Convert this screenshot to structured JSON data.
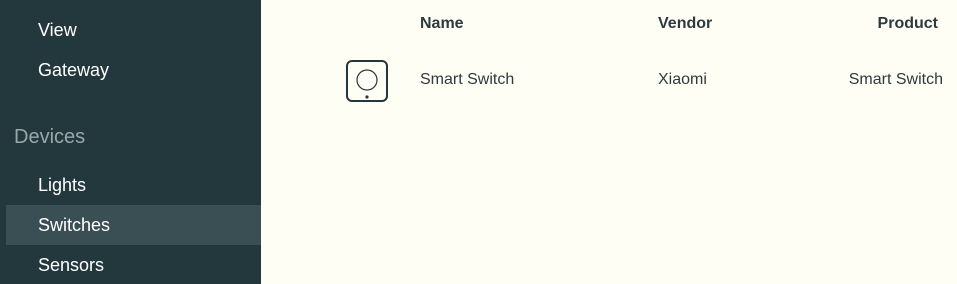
{
  "sidebar": {
    "items_top": [
      {
        "label": "View"
      },
      {
        "label": "Gateway"
      }
    ],
    "section_heading": "Devices",
    "items_devices": [
      {
        "label": "Lights"
      },
      {
        "label": "Switches",
        "active": true
      },
      {
        "label": "Sensors"
      }
    ]
  },
  "table": {
    "headers": {
      "name": "Name",
      "vendor": "Vendor",
      "product": "Product"
    },
    "rows": [
      {
        "icon": "switch-icon",
        "name": "Smart Switch",
        "vendor": "Xiaomi",
        "product": "Smart Switch"
      }
    ]
  },
  "colors": {
    "sidebar_bg": "#23383d",
    "sidebar_active_bg": "#3a4f53",
    "content_bg": "#fffef5",
    "text": "#2d3a3e",
    "muted": "#9aa7aa"
  }
}
